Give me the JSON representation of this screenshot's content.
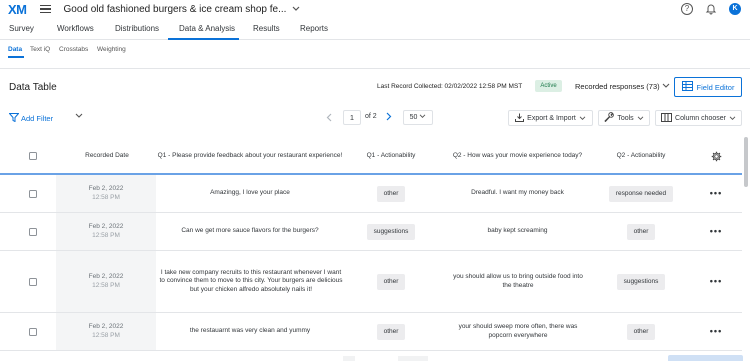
{
  "app": {
    "logo": "XM",
    "project_title": "Good old fashioned burgers & ice cream shop fe...",
    "avatar_initial": "K"
  },
  "main_nav": [
    "Survey",
    "Workflows",
    "Distributions",
    "Data & Analysis",
    "Results",
    "Reports"
  ],
  "main_nav_active": "Data & Analysis",
  "sub_nav": [
    "Data",
    "Text iQ",
    "Crosstabs",
    "Weighting"
  ],
  "sub_nav_active": "Data",
  "data_table": {
    "title": "Data Table",
    "last_record": "Last Record Collected: 02/02/2022 12:58 PM MST",
    "status": "Active",
    "recorded_responses": "Recorded responses (73)",
    "field_editor": "Field Editor"
  },
  "toolbar": {
    "add_filter": "Add Filter",
    "page": "1",
    "of_pages": "of 2",
    "per_page": "50",
    "export_import": "Export & Import",
    "tools": "Tools",
    "column_chooser": "Column chooser"
  },
  "table": {
    "headers": {
      "recorded_date": "Recorded Date",
      "q1": "Q1 - Please provide feedback about your restaurant experience!",
      "q1_action": "Q1 - Actionability",
      "q2": "Q2 - How was your movie experience today?",
      "q2_action": "Q2 - Actionability"
    },
    "rows": [
      {
        "date": "Feb 2, 2022",
        "time": "12:58 PM",
        "q1": "Amazingg, I love your place",
        "q1_action": "other",
        "q2": "Dreadful. I want my money back",
        "q2_action": "response needed"
      },
      {
        "date": "Feb 2, 2022",
        "time": "12:58 PM",
        "q1": "Can we get more sauce flavors for the burgers?",
        "q1_action": "suggestions",
        "q2": "baby kept screaming",
        "q2_action": "other"
      },
      {
        "date": "Feb 2, 2022",
        "time": "12:58 PM",
        "q1": "I take new company recruits to this restaurant whenever I want to convince them to move to this city. Your burgers are delicious but your chicken alfredo absolutely nails it!",
        "q1_action": "other",
        "q2": "you should allow us to bring outside food into the theatre",
        "q2_action": "suggestions"
      },
      {
        "date": "Feb 2, 2022",
        "time": "12:58 PM",
        "q1": "the restauarnt was very clean and yummy",
        "q1_action": "other",
        "q2": "your should sweep more often, there was popcorn everywhere",
        "q2_action": "other"
      }
    ]
  },
  "colors": {
    "accent": "#0b72d8",
    "active_badge_bg": "#dcefe4",
    "active_badge_text": "#1d7a4b",
    "chip_bg": "#ececee"
  },
  "icons": [
    "hamburger-icon",
    "help-icon",
    "bell-icon",
    "filter-icon",
    "chevron-down-icon",
    "chevron-left-icon",
    "chevron-right-icon",
    "download-icon",
    "wrench-icon",
    "columns-icon",
    "field-editor-icon",
    "gear-icon",
    "more-icon"
  ]
}
